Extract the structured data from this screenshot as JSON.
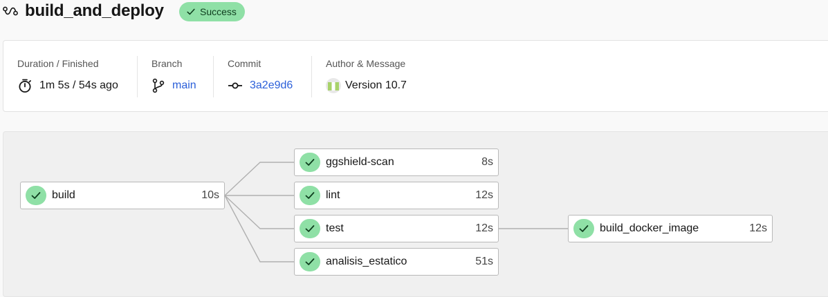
{
  "header": {
    "icon": "workflow-icon",
    "title": "build_and_deploy",
    "status": "Success",
    "status_color": "#8fe0a6"
  },
  "summary": {
    "duration": {
      "label": "Duration / Finished",
      "value": "1m 5s / 54s ago",
      "icon": "stopwatch-icon"
    },
    "branch": {
      "label": "Branch",
      "value": "main",
      "icon": "branch-icon"
    },
    "commit": {
      "label": "Commit",
      "value": "3a2e9d6",
      "icon": "commit-icon"
    },
    "author": {
      "label": "Author & Message",
      "value": "Version 10.7",
      "icon": "avatar"
    }
  },
  "jobs": {
    "build": {
      "name": "build",
      "duration": "10s",
      "status": "success"
    },
    "ggshield": {
      "name": "ggshield-scan",
      "duration": "8s",
      "status": "success"
    },
    "lint": {
      "name": "lint",
      "duration": "12s",
      "status": "success"
    },
    "test": {
      "name": "test",
      "duration": "12s",
      "status": "success"
    },
    "analisis": {
      "name": "analisis_estatico",
      "duration": "51s",
      "status": "success"
    },
    "docker": {
      "name": "build_docker_image",
      "duration": "12s",
      "status": "success"
    }
  },
  "colors": {
    "success": "#8fe0a6",
    "link": "#2b5fd9",
    "connector": "#b0b0b0"
  }
}
